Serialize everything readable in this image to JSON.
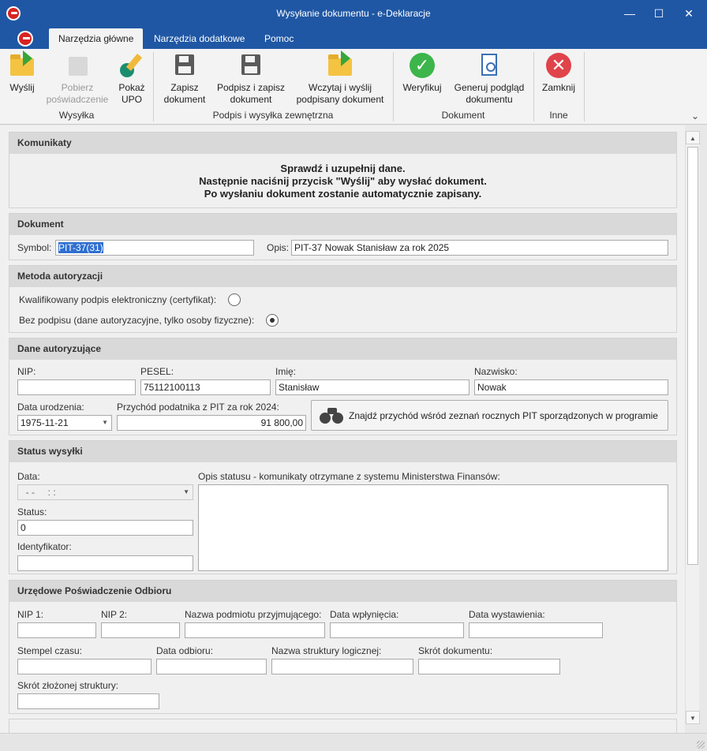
{
  "window": {
    "title": "Wysyłanie dokumentu - e-Deklaracje",
    "min_icon": "minimize-icon",
    "max_icon": "maximize-icon",
    "close_icon": "close-icon"
  },
  "tabs": [
    "Narzędzia główne",
    "Narzędzia dodatkowe",
    "Pomoc"
  ],
  "ribbon": {
    "buttons": {
      "wyslij": "Wyślij",
      "pobierz_line1": "Pobierz",
      "pobierz_line2": "poświadczenie",
      "pokaz_line1": "Pokaż",
      "pokaz_line2": "UPO",
      "zapisz_line1": "Zapisz",
      "zapisz_line2": "dokument",
      "podpisz_line1": "Podpisz i zapisz",
      "podpisz_line2": "dokument",
      "wczytaj_line1": "Wczytaj i wyślij",
      "wczytaj_line2": "podpisany dokument",
      "weryfikuj": "Weryfikuj",
      "generuj_line1": "Generuj podgląd",
      "generuj_line2": "dokumentu",
      "zamknij": "Zamknij"
    },
    "groups": {
      "wysylka": "Wysyłka",
      "podpis": "Podpis i wysyłka zewnętrzna",
      "dokument": "Dokument",
      "inne": "Inne"
    },
    "collapse_icon": "chevron-down-icon"
  },
  "komunikaty": {
    "header": "Komunikaty",
    "line1": "Sprawdź i uzupełnij dane.",
    "line2": "Następnie naciśnij przycisk \"Wyślij\" aby wysłać dokument.",
    "line3": "Po wysłaniu dokument zostanie automatycznie zapisany."
  },
  "dokument": {
    "header": "Dokument",
    "symbol_label": "Symbol:",
    "symbol_value": "PIT-37(31)",
    "opis_label": "Opis:",
    "opis_value": "PIT-37 Nowak Stanisław za rok 2025"
  },
  "metoda": {
    "header": "Metoda autoryzacji",
    "option1": "Kwalifikowany podpis elektroniczny (certyfikat):",
    "option2": "Bez podpisu (dane autoryzacyjne, tylko osoby fizyczne):",
    "selected": "option2"
  },
  "dane": {
    "header": "Dane autoryzujące",
    "nip_label": "NIP:",
    "nip_value": "",
    "pesel_label": "PESEL:",
    "pesel_value": "75112100113",
    "imie_label": "Imię:",
    "imie_value": "Stanisław",
    "nazwisko_label": "Nazwisko:",
    "nazwisko_value": "Nowak",
    "data_ur_label": "Data urodzenia:",
    "data_ur_value": "1975-11-21",
    "przychod_label": "Przychód podatnika z PIT za rok 2024:",
    "przychod_value": "91 800,00",
    "find_button": "Znajdź przychód wśród zeznań rocznych PIT sporządzonych w programie"
  },
  "status": {
    "header": "Status wysyłki",
    "data_label": "Data:",
    "data_value": "  - -     : :",
    "opis_label": "Opis statusu - komunikaty otrzymane z systemu Ministerstwa Finansów:",
    "status_label": "Status:",
    "status_value": "0",
    "ident_label": "Identyfikator:",
    "ident_value": ""
  },
  "upo": {
    "header": "Urzędowe Poświadczenie Odbioru",
    "nip1": "NIP 1:",
    "nip2": "NIP 2:",
    "nazwa_podmiotu": "Nazwa podmiotu przyjmującego:",
    "data_wplyniecia": "Data wpłynięcia:",
    "data_wystawienia": "Data wystawienia:",
    "stempel": "Stempel czasu:",
    "data_odbioru": "Data odbioru:",
    "nazwa_struktury": "Nazwa struktury logicznej:",
    "skrot_dokumentu": "Skrót dokumentu:",
    "skrot_struktury": "Skrót złożonej struktury:"
  },
  "colors": {
    "titlebar": "#1f57a4",
    "ok": "#3cb54a",
    "close": "#e0434a"
  }
}
